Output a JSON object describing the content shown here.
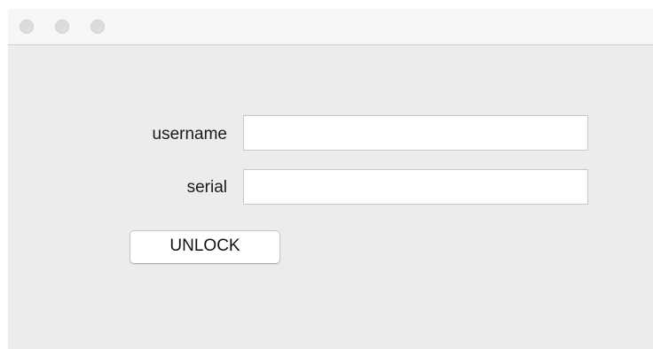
{
  "window": {
    "traffic_lights": [
      "close",
      "minimize",
      "maximize"
    ]
  },
  "form": {
    "username_label": "username",
    "username_value": "",
    "serial_label": "serial",
    "serial_value": "",
    "unlock_label": "UNLOCK"
  },
  "colors": {
    "window_background": "#ececec",
    "titlebar_background": "#f6f6f6",
    "traffic_light_inactive": "#dcdcdc"
  }
}
